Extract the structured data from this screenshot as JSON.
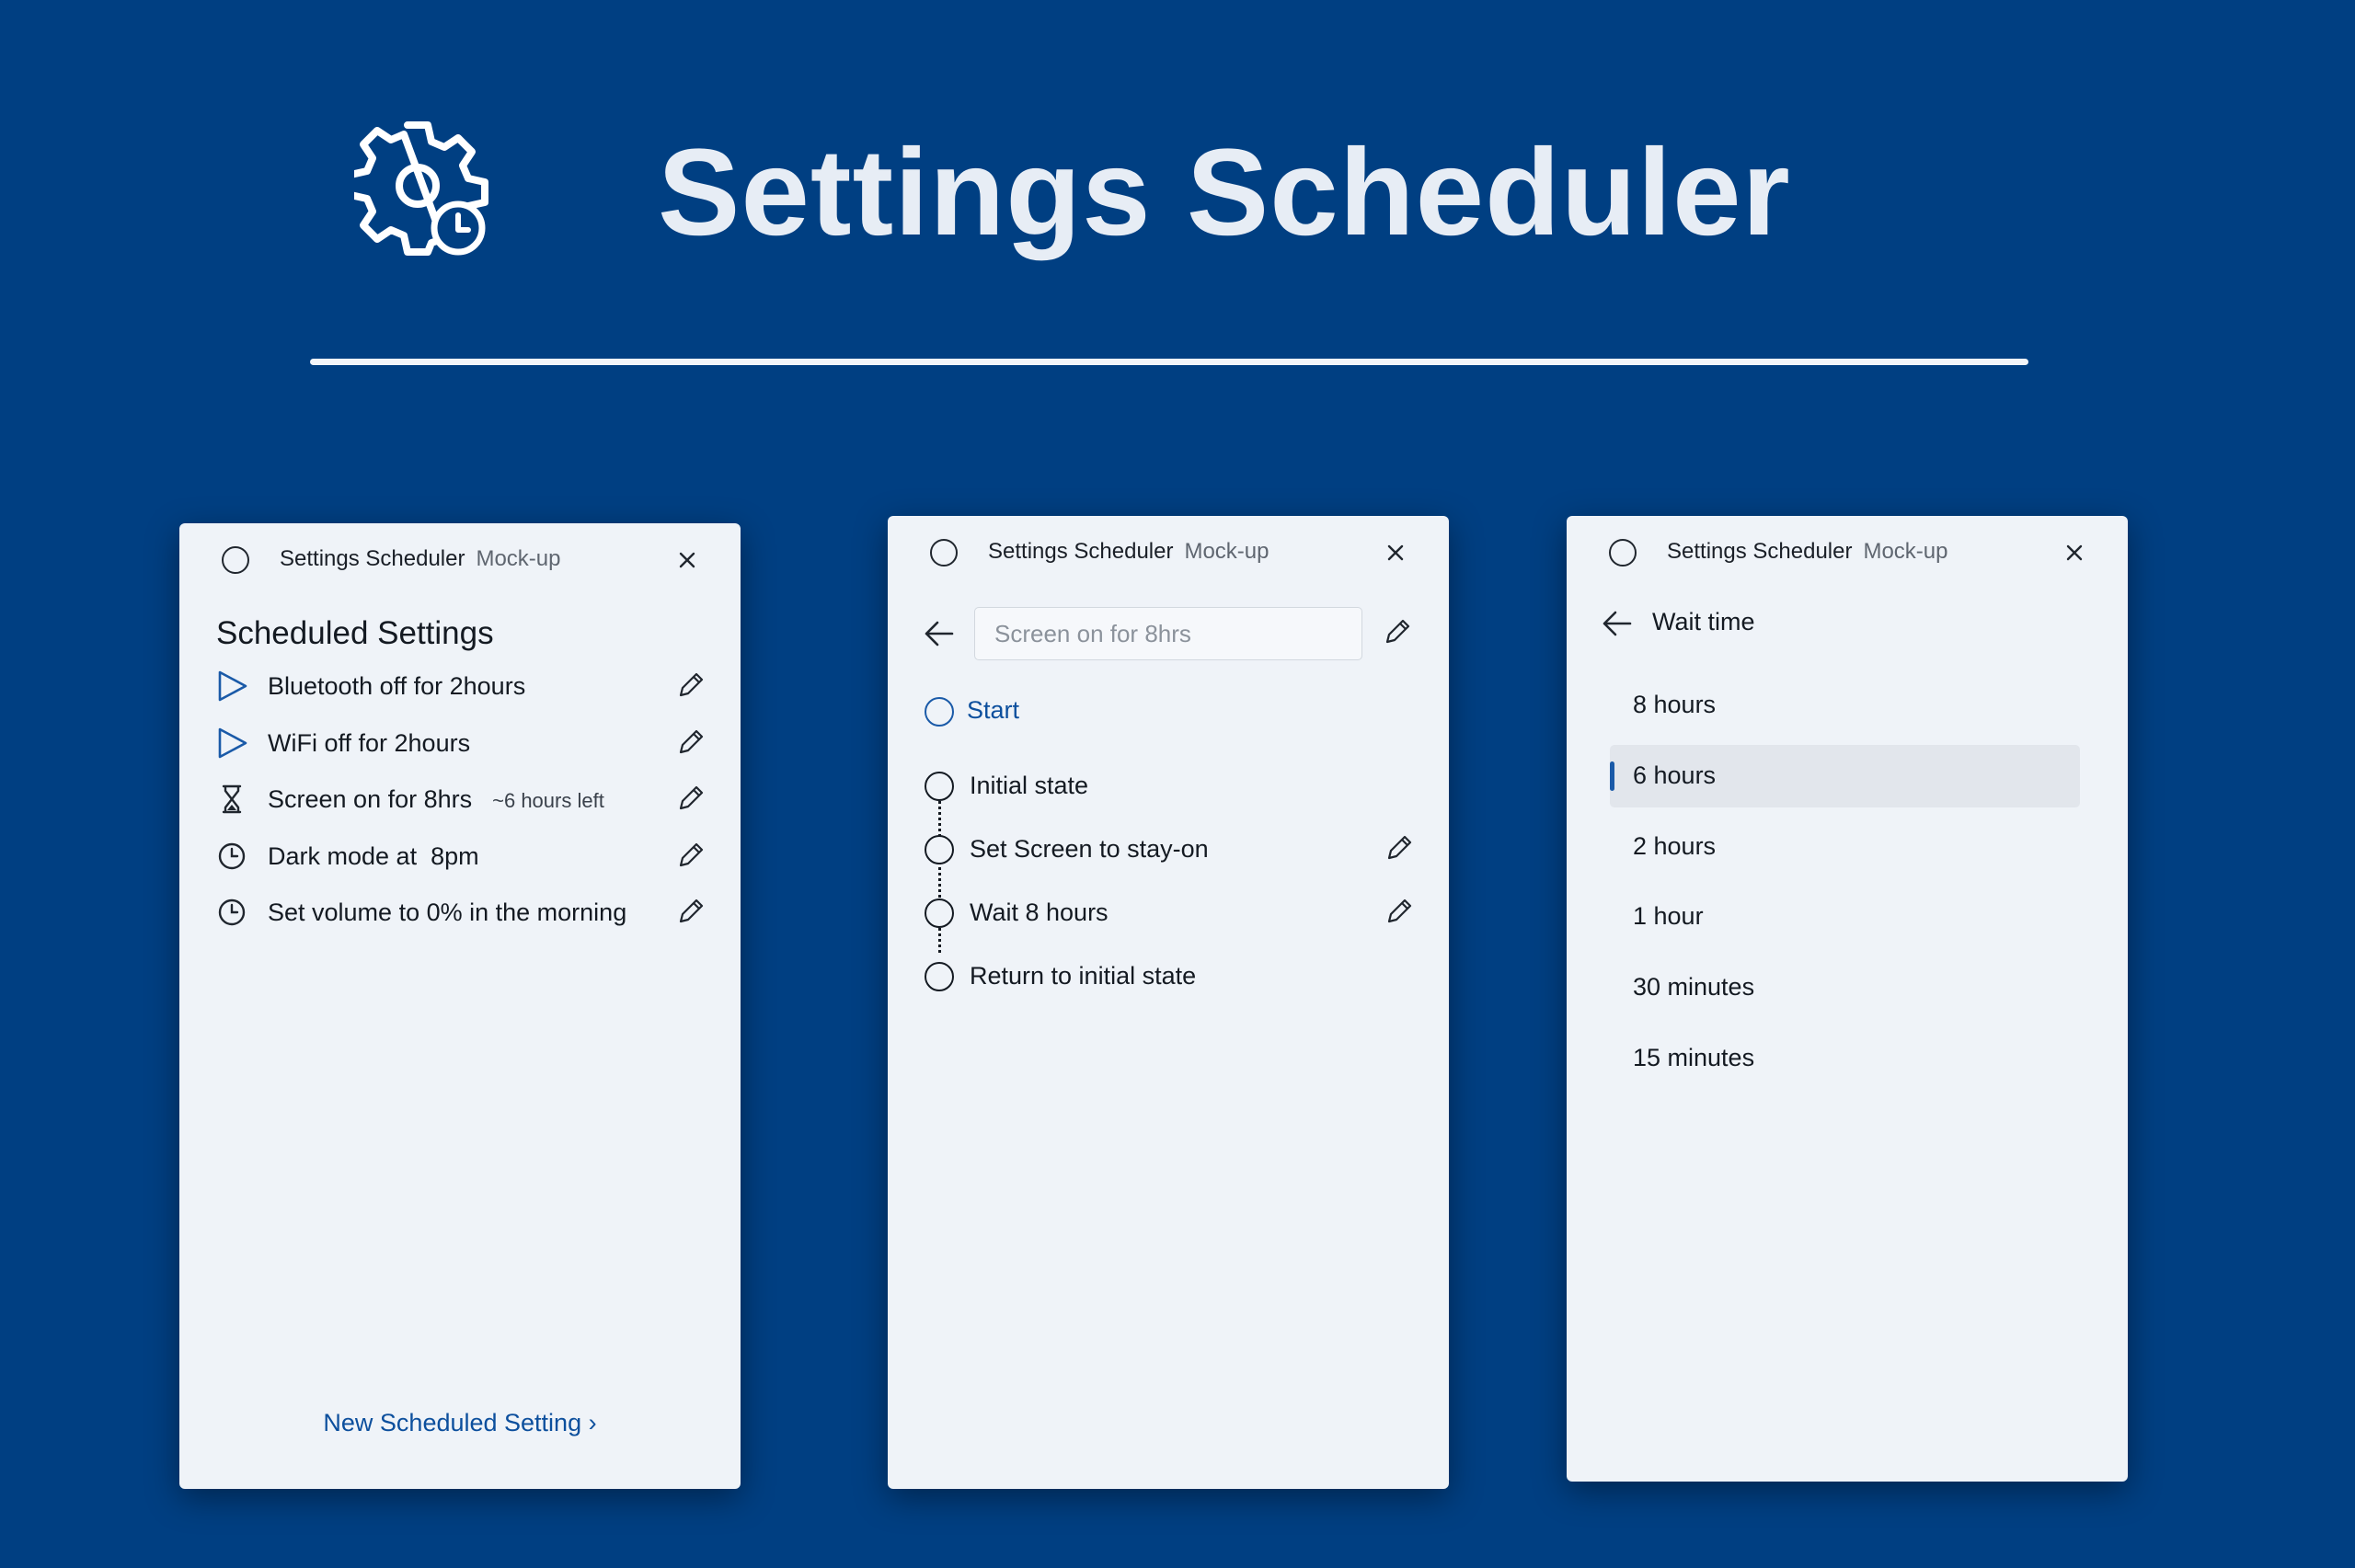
{
  "hero": {
    "title": "Settings Scheduler",
    "icon": "gear-clock-icon"
  },
  "colors": {
    "background": "#003f82",
    "window": "#eff3f8",
    "accent": "#0c4f9d",
    "selected": "#e2e6ec"
  },
  "windows": {
    "titlebar": {
      "app_name": "Settings Scheduler",
      "subtitle": "Mock-up"
    },
    "list": {
      "heading": "Scheduled Settings",
      "items": [
        {
          "icon": "play-icon",
          "label": "Bluetooth off for 2hours",
          "note": ""
        },
        {
          "icon": "play-icon",
          "label": "WiFi off for 2hours",
          "note": ""
        },
        {
          "icon": "hourglass-icon",
          "label": "Screen on for 8hrs",
          "note": "~6 hours left"
        },
        {
          "icon": "clock-icon",
          "label": "Dark mode at  8pm",
          "note": ""
        },
        {
          "icon": "clock-icon",
          "label": "Set volume to 0% in the morning",
          "note": ""
        }
      ],
      "new_link": "New Scheduled Setting ›"
    },
    "detail": {
      "name_placeholder": "Screen on for 8hrs",
      "start_label": "Start",
      "steps": [
        {
          "label": "Initial state",
          "editable": false
        },
        {
          "label": "Set Screen to stay-on",
          "editable": true
        },
        {
          "label": "Wait 8 hours",
          "editable": true
        },
        {
          "label": "Return to initial state",
          "editable": false
        }
      ]
    },
    "wait": {
      "title": "Wait time",
      "options": [
        {
          "label": "8 hours",
          "selected": false
        },
        {
          "label": "6 hours",
          "selected": true
        },
        {
          "label": "2 hours",
          "selected": false
        },
        {
          "label": "1 hour",
          "selected": false
        },
        {
          "label": "30 minutes",
          "selected": false
        },
        {
          "label": "15 minutes",
          "selected": false
        }
      ]
    }
  }
}
